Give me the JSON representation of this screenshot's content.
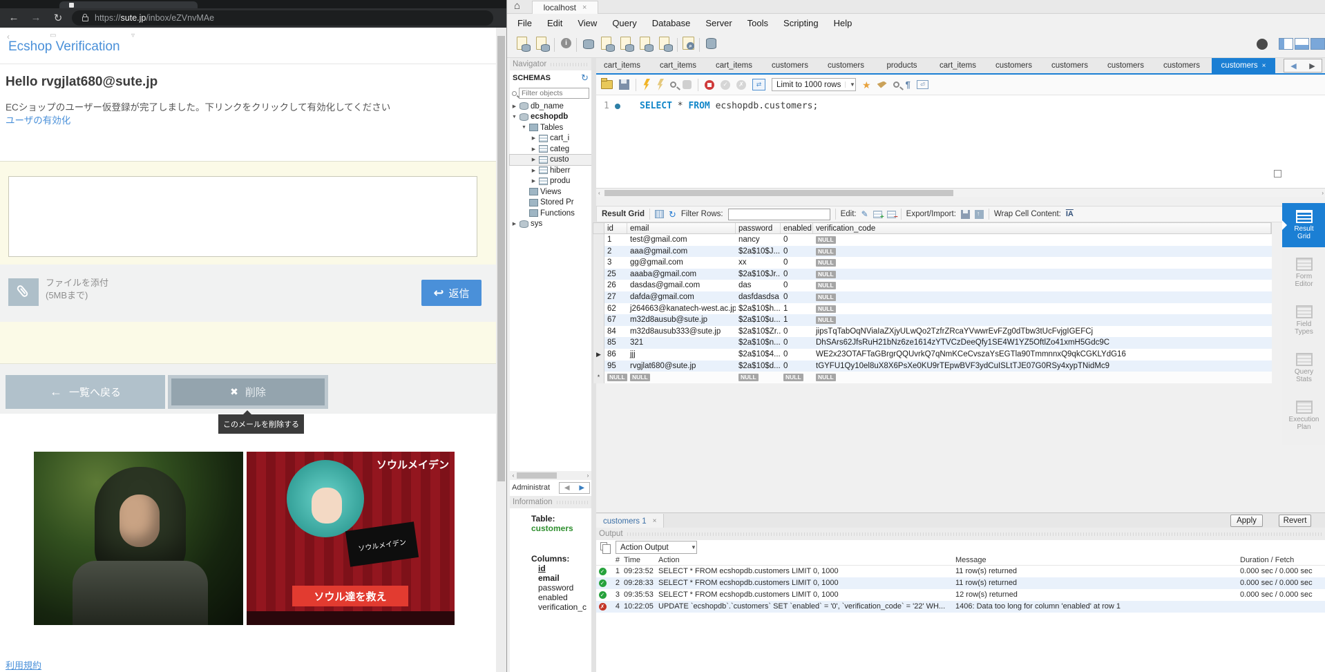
{
  "browser": {
    "url_scheme": "https://",
    "url_host": "sute.jp",
    "url_path": "/inbox/eZVnvMAe",
    "nav": {
      "back": "←",
      "forward": "→",
      "reload": "↻"
    },
    "email": {
      "subject": "Ecshop Verification",
      "greeting": "Hello rvgjlat680@sute.jp",
      "body": "ECショップのユーザー仮登録が完了しました。下リンクをクリックして有効化してください",
      "activation_link": "ユーザの有効化"
    },
    "compose": {
      "attach_label": "ファイルを添付",
      "attach_limit": "(5MBまで)",
      "reply": "返信",
      "reply_icon": "↩"
    },
    "actions": {
      "back": "一覧へ戻る",
      "back_icon": "←",
      "delete": "削除",
      "delete_icon": "✖",
      "tooltip": "このメールを削除する"
    },
    "ads": {
      "title": "ソウルメイデン",
      "placard": "ソウルメイデン",
      "button": "ソウル達を救え"
    },
    "footer_link": "利用規約"
  },
  "workbench": {
    "window_tab": "localhost",
    "window_tab_close": "×",
    "menu": [
      "File",
      "Edit",
      "View",
      "Query",
      "Database",
      "Server",
      "Tools",
      "Scripting",
      "Help"
    ],
    "query_tabs": [
      {
        "label": "cart_items",
        "cls": "",
        "close": ""
      },
      {
        "label": "cart_items",
        "cls": "",
        "close": ""
      },
      {
        "label": "cart_items",
        "cls": "",
        "close": ""
      },
      {
        "label": "customers",
        "cls": "",
        "close": ""
      },
      {
        "label": "customers",
        "cls": "",
        "close": ""
      },
      {
        "label": "products",
        "cls": "",
        "close": ""
      },
      {
        "label": "cart_items",
        "cls": "",
        "close": ""
      },
      {
        "label": "customers",
        "cls": "",
        "close": ""
      },
      {
        "label": "customers",
        "cls": "",
        "close": ""
      },
      {
        "label": "customers",
        "cls": "",
        "close": ""
      },
      {
        "label": "customers",
        "cls": "",
        "close": ""
      },
      {
        "label": "customers",
        "cls": "active",
        "close": "×"
      }
    ],
    "tab_nav": {
      "prev": "◀",
      "next": "▶"
    },
    "navigator": {
      "title": "Navigator",
      "schemas_label": "SCHEMAS",
      "refresh_icon": "↻",
      "filter_placeholder": "Filter objects",
      "tree": [
        {
          "arrow": "▶",
          "icon": "db",
          "label": "db_name",
          "cls": ""
        },
        {
          "arrow": "▼",
          "icon": "db",
          "label": "ecshopdb",
          "cls": "bold"
        },
        {
          "arrow": "▼",
          "icon": "folder",
          "label": "Tables",
          "cls": "ind1"
        },
        {
          "arrow": "▶",
          "icon": "table",
          "label": "cart_i",
          "cls": "ind2"
        },
        {
          "arrow": "▶",
          "icon": "table",
          "label": "categ",
          "cls": "ind2"
        },
        {
          "arrow": "▶",
          "icon": "table",
          "label": "custo",
          "cls": "ind2 selected"
        },
        {
          "arrow": "▶",
          "icon": "table",
          "label": "hiberr",
          "cls": "ind2"
        },
        {
          "arrow": "▶",
          "icon": "table",
          "label": "produ",
          "cls": "ind2"
        },
        {
          "arrow": "",
          "icon": "folder",
          "label": "Views",
          "cls": "ind1"
        },
        {
          "arrow": "",
          "icon": "folder",
          "label": "Stored Pr",
          "cls": "ind1"
        },
        {
          "arrow": "",
          "icon": "folder",
          "label": "Functions",
          "cls": "ind1"
        },
        {
          "arrow": "▶",
          "icon": "db",
          "label": "sys",
          "cls": ""
        }
      ],
      "admin_label": "Administrat",
      "admin_prev": "◀",
      "admin_next": "▶",
      "information_label": "Information",
      "info": {
        "table_label": "Table:",
        "table_name": "customers",
        "columns_label": "Columns:",
        "columns": [
          {
            "label": "id",
            "cls": "c0"
          },
          {
            "label": "email",
            "cls": "c1"
          },
          {
            "label": "password",
            "cls": ""
          },
          {
            "label": "enabled",
            "cls": ""
          },
          {
            "label": "verification_c",
            "cls": ""
          }
        ]
      }
    },
    "editor": {
      "line_no": "1",
      "kw1": "SELECT",
      "mid": " * ",
      "kw2": "FROM",
      "rest": " ecshopdb.customers;",
      "limit": "Limit to 1000 rows",
      "limit_arrow": "▼"
    },
    "grid": {
      "toolbar": {
        "title": "Result Grid",
        "refresh_icon": "↻",
        "filter": "Filter Rows:",
        "edit": "Edit:",
        "pencil_icon": "✎",
        "export": "Export/Import:",
        "wrap": "Wrap Cell Content:",
        "wrap_icon": "IA"
      },
      "columns": [
        {
          "label": "id",
          "cls": "c-id"
        },
        {
          "label": "email",
          "cls": "c-em"
        },
        {
          "label": "password",
          "cls": "c-pw"
        },
        {
          "label": "enabled",
          "cls": "c-en"
        },
        {
          "label": "verification_code",
          "cls": "c-vc"
        }
      ],
      "rows": [
        {
          "marker": "",
          "id": "1",
          "email": "test@gmail.com",
          "password": "nancy",
          "enabled": "0",
          "code": "NULL"
        },
        {
          "marker": "",
          "id": "2",
          "email": "aaa@gmail.com",
          "password": "$2a$10$J...",
          "enabled": "0",
          "code": "NULL"
        },
        {
          "marker": "",
          "id": "3",
          "email": "gg@gmail.com",
          "password": "xx",
          "enabled": "0",
          "code": "NULL"
        },
        {
          "marker": "",
          "id": "25",
          "email": "aaaba@gmail.com",
          "password": "$2a$10$Jr...",
          "enabled": "0",
          "code": "NULL"
        },
        {
          "marker": "",
          "id": "26",
          "email": "dasdas@gmail.com",
          "password": "das",
          "enabled": "0",
          "code": "NULL"
        },
        {
          "marker": "",
          "id": "27",
          "email": "dafda@gmail.com",
          "password": "dasfdasdsa",
          "enabled": "0",
          "code": "NULL"
        },
        {
          "marker": "",
          "id": "62",
          "email": "j264663@kanatech-west.ac.jp",
          "password": "$2a$10$h...",
          "enabled": "1",
          "code": "NULL"
        },
        {
          "marker": "",
          "id": "67",
          "email": "m32d8ausub@sute.jp",
          "password": "$2a$10$u...",
          "enabled": "1",
          "code": "NULL"
        },
        {
          "marker": "",
          "id": "84",
          "email": "m32d8ausub333@sute.jp",
          "password": "$2a$10$Zr...",
          "enabled": "0",
          "code": "jipsTqTabOqNViaIaZXjyULwQo2TzfrZRcaYVwwrEvFZg0dTbw3tUcFvjgIGEFCj"
        },
        {
          "marker": "",
          "id": "85",
          "email": "321",
          "password": "$2a$10$n....",
          "enabled": "0",
          "code": "DhSArs62JfsRuH21bNz6ze1614zYTVCzDeeQfy1SE4W1YZ5OftlZo41xmH5Gdc9C"
        },
        {
          "marker": "▶",
          "id": "86",
          "email": "jjj",
          "password": "$2a$10$4...",
          "enabled": "0",
          "code": "WE2x23OTAFTaGBrgrQQUvrkQ7qNmKCeCvszaYsEGTla90TmmnnxQ9qkCGKLYdG16"
        },
        {
          "marker": "",
          "id": "95",
          "email": "rvgjlat680@sute.jp",
          "password": "$2a$10$d...",
          "enabled": "0",
          "code": "tGYFU1Qy10el8uX8X6PsXe0KU9rTEpwBVF3ydCuISLtTJE07G0RSy4xypTNidMc9"
        },
        {
          "marker": "*",
          "id": "NULL",
          "email": "NULL",
          "password": "NULL",
          "enabled": "NULL",
          "code": "NULL"
        }
      ]
    },
    "sidebar": [
      {
        "l1": "Result",
        "l2": "Grid",
        "cls": "active"
      },
      {
        "l1": "Form",
        "l2": "Editor",
        "cls": ""
      },
      {
        "l1": "Field",
        "l2": "Types",
        "cls": ""
      },
      {
        "l1": "Query",
        "l2": "Stats",
        "cls": ""
      },
      {
        "l1": "Execution",
        "l2": "Plan",
        "cls": ""
      }
    ],
    "bottom": {
      "tab": "customers 1",
      "tab_close": "×",
      "apply": "Apply",
      "revert": "Revert"
    },
    "output": {
      "label": "Output",
      "dropdown": "Action Output",
      "dropdown_arrow": "▼",
      "columns": [
        {
          "label": "",
          "cls": "o-st"
        },
        {
          "label": "#",
          "cls": "o-num"
        },
        {
          "label": "Time",
          "cls": "o-time"
        },
        {
          "label": "Action",
          "cls": "o-act"
        },
        {
          "label": "Message",
          "cls": "o-msg"
        },
        {
          "label": "Duration / Fetch",
          "cls": "o-dur"
        }
      ],
      "rows": [
        {
          "cls": "ok",
          "glyph": "✓",
          "num": "1",
          "time": "09:23:52",
          "action": "SELECT * FROM ecshopdb.customers LIMIT 0, 1000",
          "message": "11 row(s) returned",
          "duration": "0.000 sec / 0.000 sec"
        },
        {
          "cls": "ok",
          "glyph": "✓",
          "num": "2",
          "time": "09:28:33",
          "action": "SELECT * FROM ecshopdb.customers LIMIT 0, 1000",
          "message": "11 row(s) returned",
          "duration": "0.000 sec / 0.000 sec"
        },
        {
          "cls": "ok",
          "glyph": "✓",
          "num": "3",
          "time": "09:35:53",
          "action": "SELECT * FROM ecshopdb.customers LIMIT 0, 1000",
          "message": "12 row(s) returned",
          "duration": "0.000 sec / 0.000 sec"
        },
        {
          "cls": "error",
          "glyph": "✗",
          "num": "4",
          "time": "10:22:05",
          "action": "UPDATE `ecshopdb`.`customers` SET `enabled` = '0', `verification_code` = '22' WH...",
          "message": "1406: Data too long for column 'enabled' at row 1",
          "duration": ""
        }
      ]
    }
  }
}
